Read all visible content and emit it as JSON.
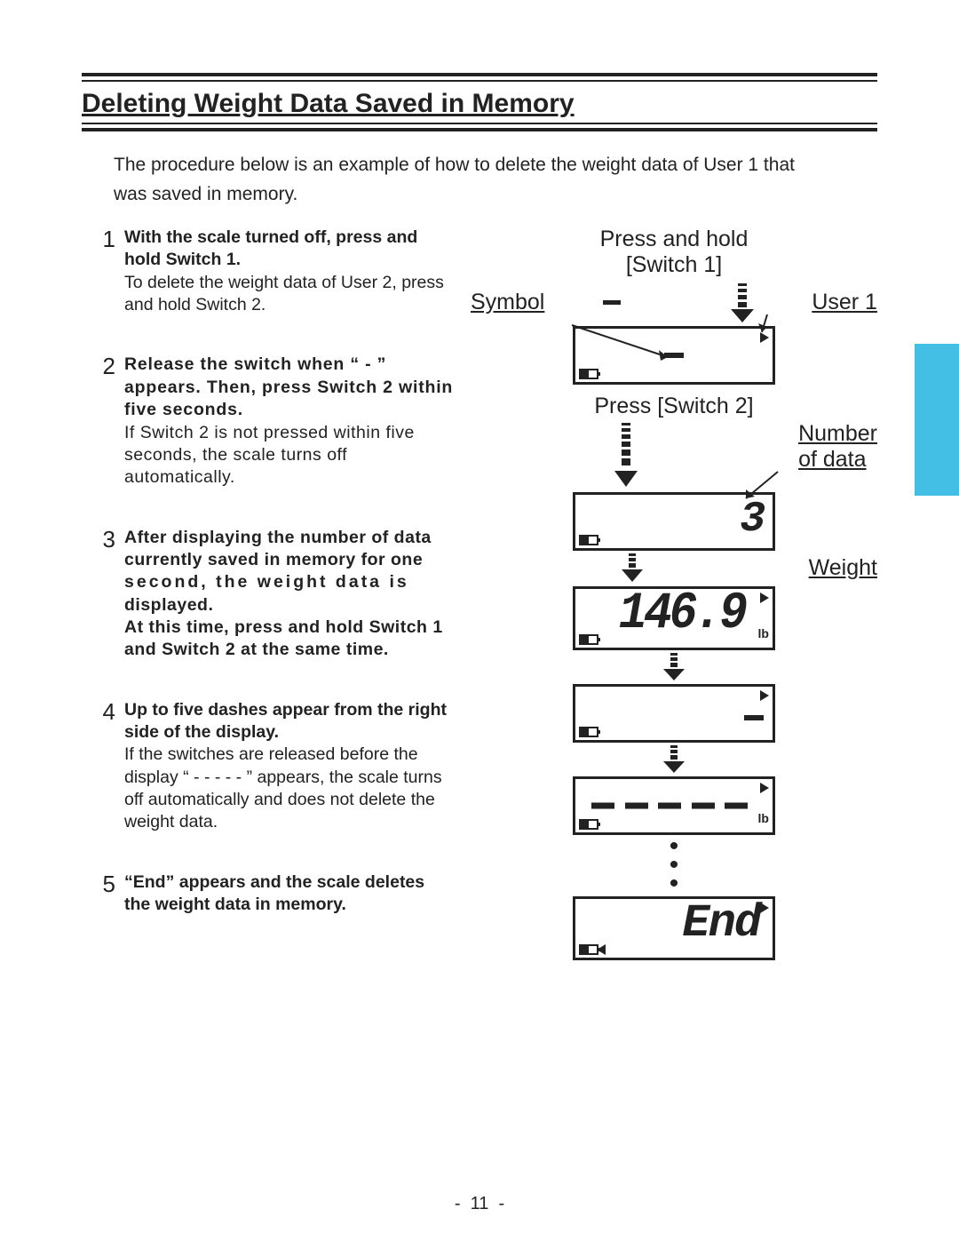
{
  "title": "Deleting Weight Data Saved in Memory",
  "intro": "The procedure below is an example of how to delete the weight data of User 1 that was saved in memory.",
  "steps": {
    "1": {
      "num": "1",
      "head": "With the scale turned off, press and hold Switch 1.",
      "body": "To delete the weight data of User 2, press and hold Switch 2."
    },
    "2": {
      "num": "2",
      "head": "Release the switch when “ - ” appears. Then, press Switch 2 within five seconds.",
      "body": "If Switch 2 is not pressed within five seconds, the scale turns off automatically."
    },
    "3": {
      "num": "3",
      "head_a": "After displaying the number of data currently saved in memory for one ",
      "head_b": "second, the weight data is",
      "head_c": " displayed.",
      "head2": "At this time, press and hold Switch 1 and Switch 2 at the same time."
    },
    "4": {
      "num": "4",
      "head": "Up to five dashes appear from the right side of the display.",
      "body": "If the switches are released before the display “ - - - - - ” appears, the scale turns off automatically and does not delete the weight data."
    },
    "5": {
      "num": "5",
      "head": "“End” appears and the scale deletes the weight data in memory."
    }
  },
  "labels": {
    "press_hold": "Press and hold",
    "switch1": "[Switch 1]",
    "symbol": "Symbol",
    "user1": "User 1",
    "press_sw2": "Press [Switch 2]",
    "num_of_data": "Number\nof data",
    "weight": "Weight",
    "lb": "lb",
    "count": "3",
    "weight_val": "146.9",
    "end": "End"
  },
  "page_number": "11"
}
